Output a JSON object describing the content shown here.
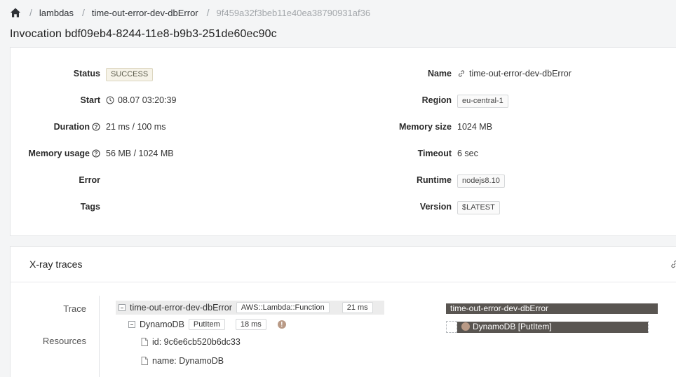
{
  "breadcrumb": {
    "items": [
      "lambdas",
      "time-out-error-dev-dbError",
      "9f459a32f3beb11e40ea38790931af36"
    ],
    "separator": "/"
  },
  "page": {
    "title": "Invocation bdf09eb4-8244-11e8-b9b3-251de60ec90c"
  },
  "summary": {
    "left": {
      "status_label": "Status",
      "status_value": "SUCCESS",
      "start_label": "Start",
      "start_value": "08.07 03:20:39",
      "duration_label": "Duration",
      "duration_value": "21 ms / 100 ms",
      "memory_usage_label": "Memory usage",
      "memory_usage_value": "56 MB / 1024 MB",
      "error_label": "Error",
      "tags_label": "Tags"
    },
    "right": {
      "name_label": "Name",
      "name_value": "time-out-error-dev-dbError",
      "region_label": "Region",
      "region_value": "eu-central-1",
      "memory_size_label": "Memory size",
      "memory_size_value": "1024 MB",
      "timeout_label": "Timeout",
      "timeout_value": "6 sec",
      "runtime_label": "Runtime",
      "runtime_value": "nodejs8.10",
      "version_label": "Version",
      "version_value": "$LATEST"
    }
  },
  "xray": {
    "title": "X-ray traces",
    "tabs": [
      "Trace",
      "Resources"
    ],
    "trace": {
      "root_name": "time-out-error-dev-dbError",
      "root_type": "AWS::Lambda::Function",
      "root_duration": "21 ms",
      "child_name": "DynamoDB",
      "child_op": "PutItem",
      "child_duration": "18 ms",
      "child_warning": "!",
      "attr_id": "id: 9c6e6cb520b6dc33",
      "attr_name": "name: DynamoDB"
    },
    "timeline": {
      "root_bar": "time-out-error-dev-dbError",
      "child_bar": "DynamoDB [PutItem]"
    }
  },
  "colors": {
    "bar": "#595551",
    "warning": "#b99a86",
    "success_tag_bg": "#f6f3e8"
  }
}
